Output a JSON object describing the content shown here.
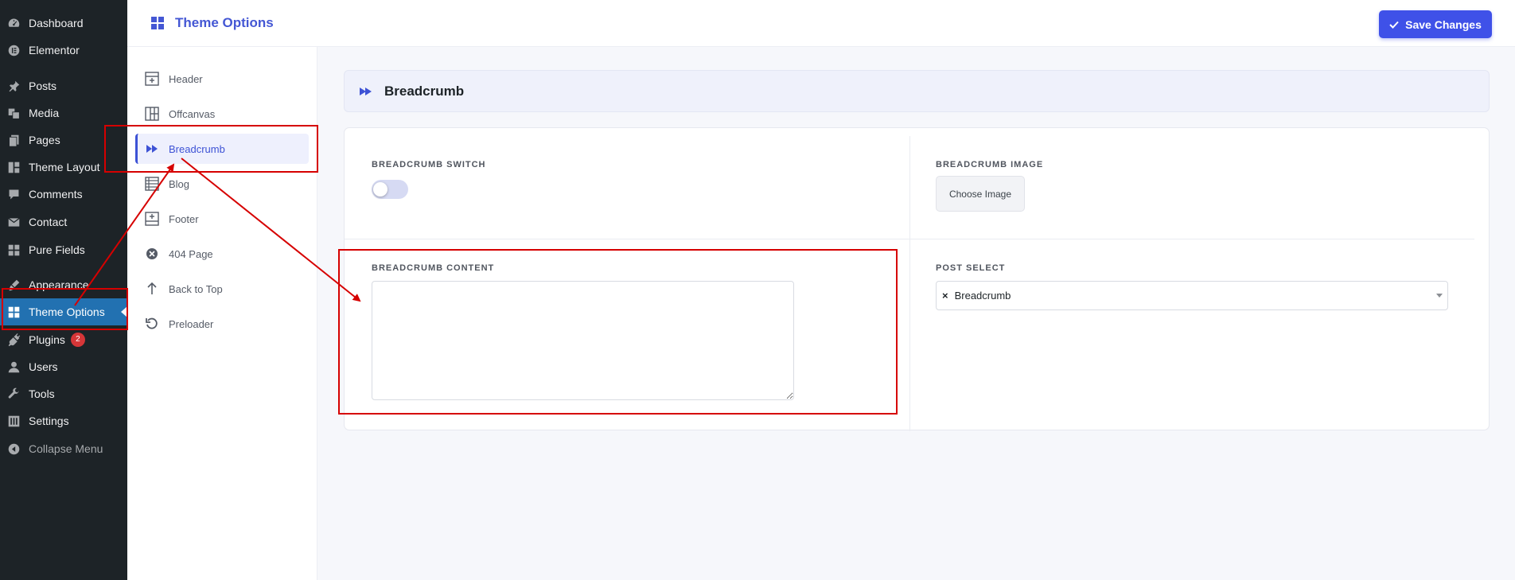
{
  "wp_menu": {
    "items": [
      {
        "label": "Dashboard",
        "icon": "dashboard-icon"
      },
      {
        "label": "Elementor",
        "icon": "elementor-icon"
      },
      {
        "label": "Posts",
        "icon": "pin-icon"
      },
      {
        "label": "Media",
        "icon": "media-icon"
      },
      {
        "label": "Pages",
        "icon": "pages-icon"
      },
      {
        "label": "Theme Layout",
        "icon": "layout-icon"
      },
      {
        "label": "Comments",
        "icon": "comment-icon"
      },
      {
        "label": "Contact",
        "icon": "mail-icon"
      },
      {
        "label": "Pure Fields",
        "icon": "grid-icon"
      },
      {
        "label": "Appearance",
        "icon": "brush-icon"
      },
      {
        "label": "Theme Options",
        "icon": "grid-icon",
        "active": true
      },
      {
        "label": "Plugins",
        "icon": "plugin-icon",
        "badge": "2"
      },
      {
        "label": "Users",
        "icon": "user-icon"
      },
      {
        "label": "Tools",
        "icon": "wrench-icon"
      },
      {
        "label": "Settings",
        "icon": "settings-icon"
      },
      {
        "label": "Collapse Menu",
        "icon": "collapse-icon"
      }
    ]
  },
  "header": {
    "title": "Theme Options",
    "save_label": "Save Changes"
  },
  "options_nav": {
    "items": [
      {
        "label": "Header",
        "icon": "header-layout-icon"
      },
      {
        "label": "Offcanvas",
        "icon": "offcanvas-layout-icon"
      },
      {
        "label": "Breadcrumb",
        "icon": "fast-forward-icon",
        "active": true
      },
      {
        "label": "Blog",
        "icon": "blog-list-icon"
      },
      {
        "label": "Footer",
        "icon": "footer-layout-icon"
      },
      {
        "label": "404 Page",
        "icon": "x-circle-icon"
      },
      {
        "label": "Back to Top",
        "icon": "arrow-up-icon"
      },
      {
        "label": "Preloader",
        "icon": "reload-icon"
      }
    ]
  },
  "section": {
    "title": "Breadcrumb",
    "switch_label": "BREADCRUMB SWITCH",
    "switch_on": false,
    "image_label": "BREADCRUMB IMAGE",
    "choose_image_label": "Choose Image",
    "content_label": "BREADCRUMB CONTENT",
    "content_value": "",
    "post_select_label": "POST SELECT",
    "post_select_value": "Breadcrumb",
    "post_select_remove": "×"
  },
  "colors": {
    "wp_sidebar_bg": "#1d2327",
    "wp_active": "#2271b1",
    "accent": "#3f51e8",
    "annotation_red": "#d60000"
  }
}
